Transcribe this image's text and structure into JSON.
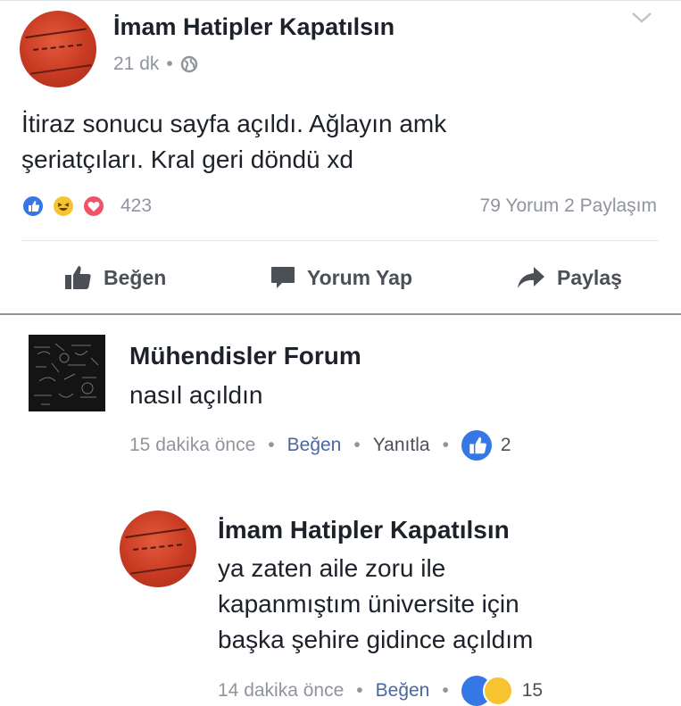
{
  "post": {
    "author": "İmam Hatipler Kapatılsın",
    "time": "21 dk",
    "separator": "•",
    "text_line1": "İtiraz sonucu sayfa açıldı. Ağlayın amk",
    "text_line2": "şeriatçıları. Kral geri döndü xd",
    "reaction_count": "423",
    "comment_share": "79 Yorum 2 Paylaşım"
  },
  "actions": {
    "like": "Beğen",
    "comment": "Yorum Yap",
    "share": "Paylaş"
  },
  "comment1": {
    "author": "Mühendisler Forum",
    "text": "nasıl açıldın",
    "time": "15 dakika önce",
    "like": "Beğen",
    "reply": "Yanıtla",
    "like_count": "2"
  },
  "comment2": {
    "author": "İmam Hatipler Kapatılsın",
    "text_line1": "ya zaten aile zoru ile",
    "text_line2": "kapanmıştım üniversite için",
    "text_line3": "başka şehire gidince açıldım",
    "time": "14 dakika önce",
    "like": "Beğen",
    "like_count": "15"
  },
  "colors": {
    "fb_blue": "#3578e5",
    "link": "#4b67a1",
    "meta_gray": "#90949c",
    "avatar_red": "#c73a22"
  },
  "icons": [
    "globe-icon",
    "chevron-down-icon",
    "like-reaction-icon",
    "haha-reaction-icon",
    "love-reaction-icon",
    "thumbs-up-icon",
    "comment-bubble-icon",
    "share-arrow-icon"
  ]
}
